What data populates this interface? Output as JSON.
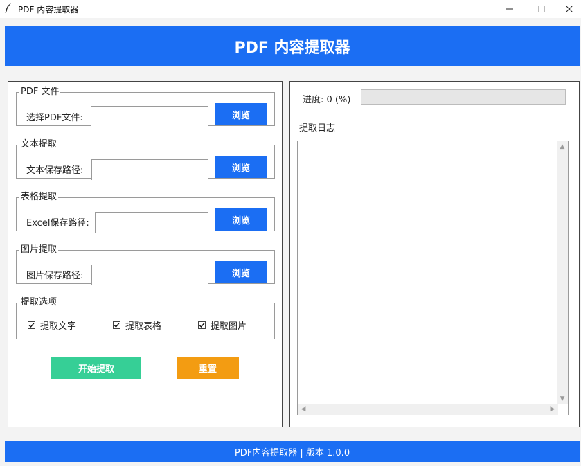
{
  "window": {
    "title": "PDF 内容提取器",
    "icon": "feather-icon"
  },
  "header": {
    "title": "PDF 内容提取器"
  },
  "pdf_group": {
    "legend": "PDF 文件",
    "label": "选择PDF文件:",
    "value": "",
    "browse": "浏览"
  },
  "text_group": {
    "legend": "文本提取",
    "label": "文本保存路径:",
    "value": "",
    "browse": "浏览"
  },
  "table_group": {
    "legend": "表格提取",
    "label": "Excel保存路径:",
    "value": "",
    "browse": "浏览"
  },
  "image_group": {
    "legend": "图片提取",
    "label": "图片保存路径:",
    "value": "",
    "browse": "浏览"
  },
  "options": {
    "legend": "提取选项",
    "items": [
      {
        "label": "提取文字",
        "checked": true
      },
      {
        "label": "提取表格",
        "checked": true
      },
      {
        "label": "提取图片",
        "checked": true
      }
    ]
  },
  "actions": {
    "start": "开始提取",
    "reset": "重置"
  },
  "progress": {
    "label": "进度: 0 (%)",
    "value": 0
  },
  "log": {
    "label": "提取日志",
    "content": ""
  },
  "footer": {
    "text": "PDF内容提取器 | 版本 1.0.0"
  },
  "colors": {
    "primary": "#1b6ef3",
    "start_button": "#36cf96",
    "reset_button": "#f39c12"
  }
}
